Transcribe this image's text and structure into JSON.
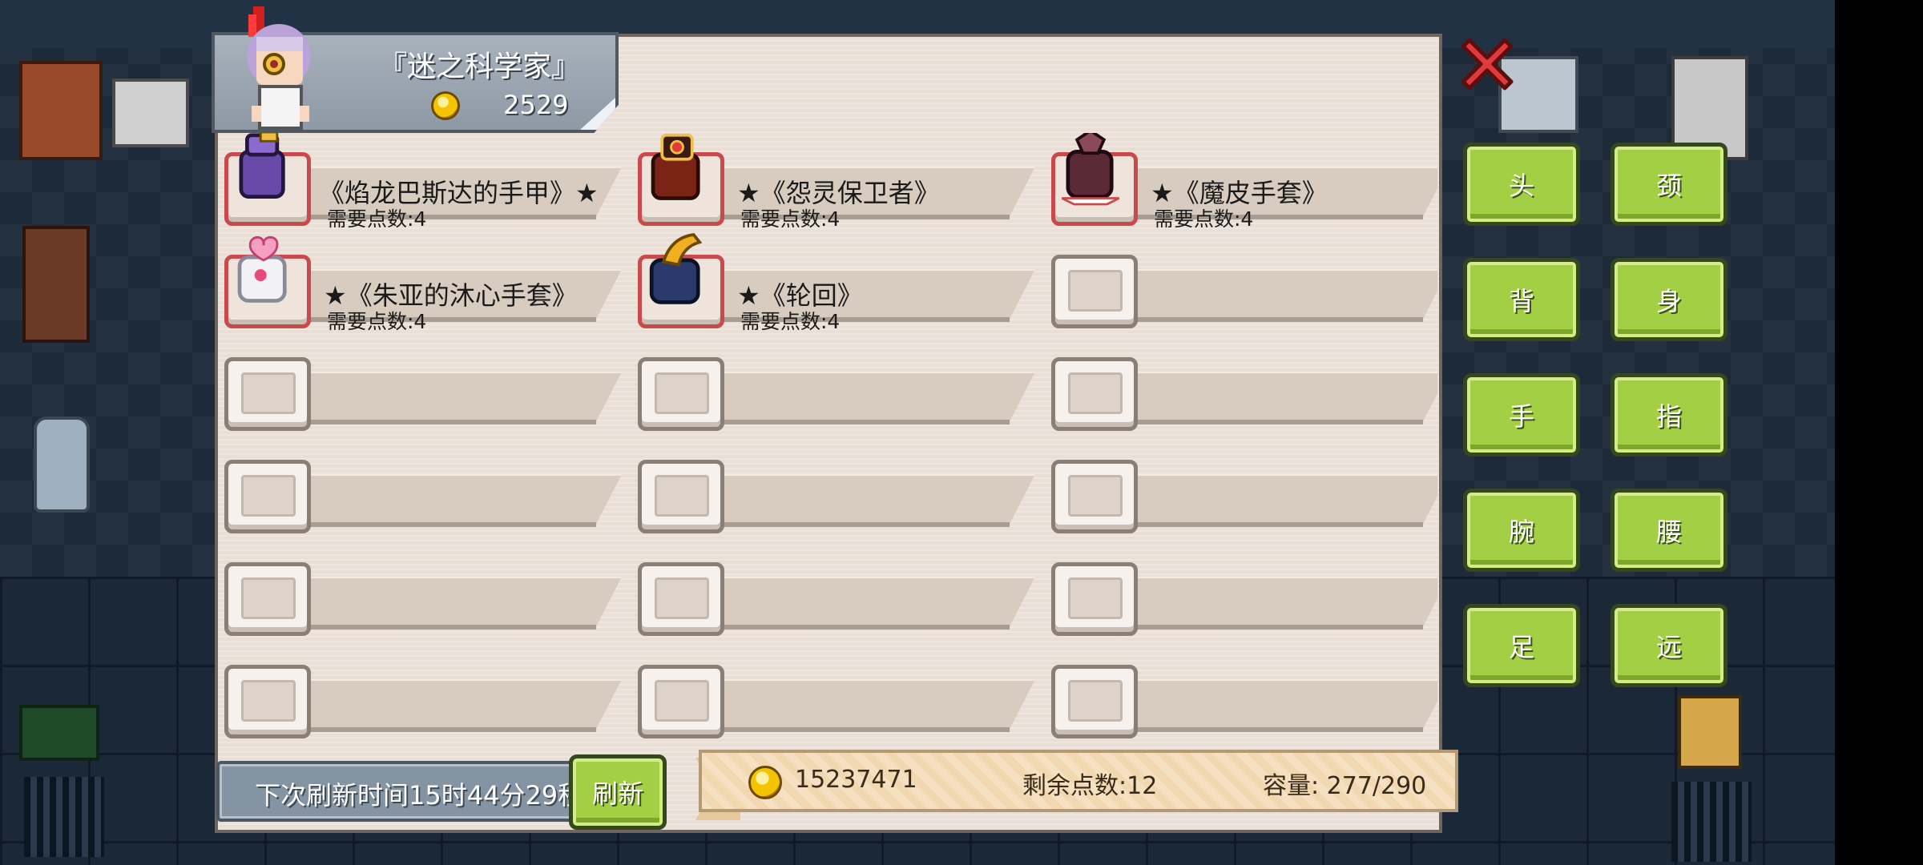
{
  "header": {
    "title": "『迷之科学家』",
    "gold": "2529"
  },
  "categories": [
    {
      "label": "头"
    },
    {
      "label": "颈"
    },
    {
      "label": "背"
    },
    {
      "label": "身"
    },
    {
      "label": "手"
    },
    {
      "label": "指"
    },
    {
      "label": "腕"
    },
    {
      "label": "腰"
    },
    {
      "label": "足"
    },
    {
      "label": "远"
    }
  ],
  "items": [
    {
      "name": "★《焰龙巴斯达的手甲》",
      "cost": "需要点数:4",
      "icon": "purple-gauntlet-icon"
    },
    {
      "name": "★《怨灵保卫者》",
      "cost": "需要点数:4",
      "icon": "red-gem-glove-icon"
    },
    {
      "name": "★《魔皮手套》",
      "cost": "需要点数:4",
      "icon": "demon-glove-icon"
    },
    {
      "name": "★《朱亚的沐心手套》",
      "cost": "需要点数:4",
      "icon": "white-heart-glove-icon"
    },
    {
      "name": "★《轮回》",
      "cost": "需要点数:4",
      "icon": "dark-blue-glove-icon"
    }
  ],
  "footer": {
    "refresh_time": "下次刷新时间15时44分29秒",
    "refresh_button": "刷新",
    "total_gold": "15237471",
    "remaining_points": "剩余点数:12",
    "capacity": "容量:  277/290"
  },
  "colors": {
    "panel_bg": "#e9dfd6",
    "button_green": "#a3cf45",
    "close_red": "#e23a3a",
    "ribbon": "#f2d8b0"
  }
}
